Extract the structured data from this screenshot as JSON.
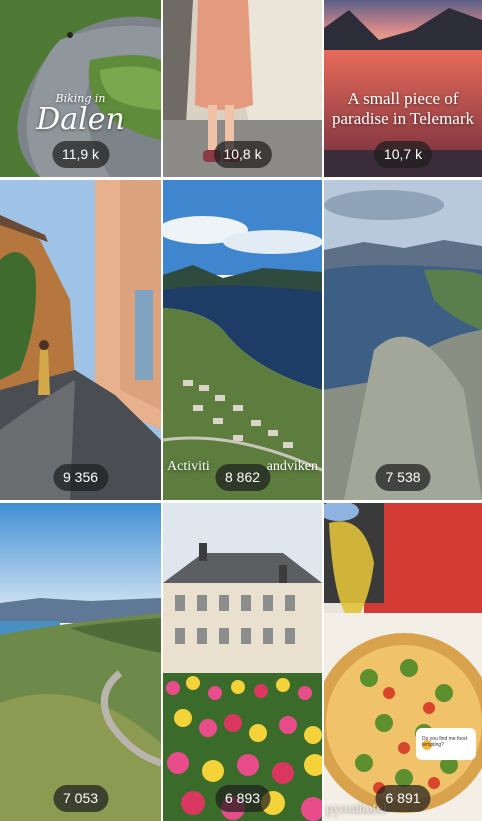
{
  "tiles": [
    {
      "id": "dalen",
      "views": "11,9 k",
      "overlay": [
        "Biking in",
        "Dalen"
      ]
    },
    {
      "id": "tent",
      "views": "10,8 k"
    },
    {
      "id": "telemark",
      "views": "10,7 k",
      "overlay": [
        "A small piece of",
        "paradise in Telemark"
      ]
    },
    {
      "id": "street",
      "views": "9 356"
    },
    {
      "id": "campsite",
      "views": "8 862",
      "overlay": [
        "Activiti",
        "andviken"
      ]
    },
    {
      "id": "mountain-lake",
      "views": "7 538"
    },
    {
      "id": "valley-road",
      "views": "7 053"
    },
    {
      "id": "tulips",
      "views": "6 893"
    },
    {
      "id": "pizza",
      "views": "6 891",
      "overlay": [
        "Do you find me food tempting?",
        "pyronhotel"
      ]
    }
  ]
}
